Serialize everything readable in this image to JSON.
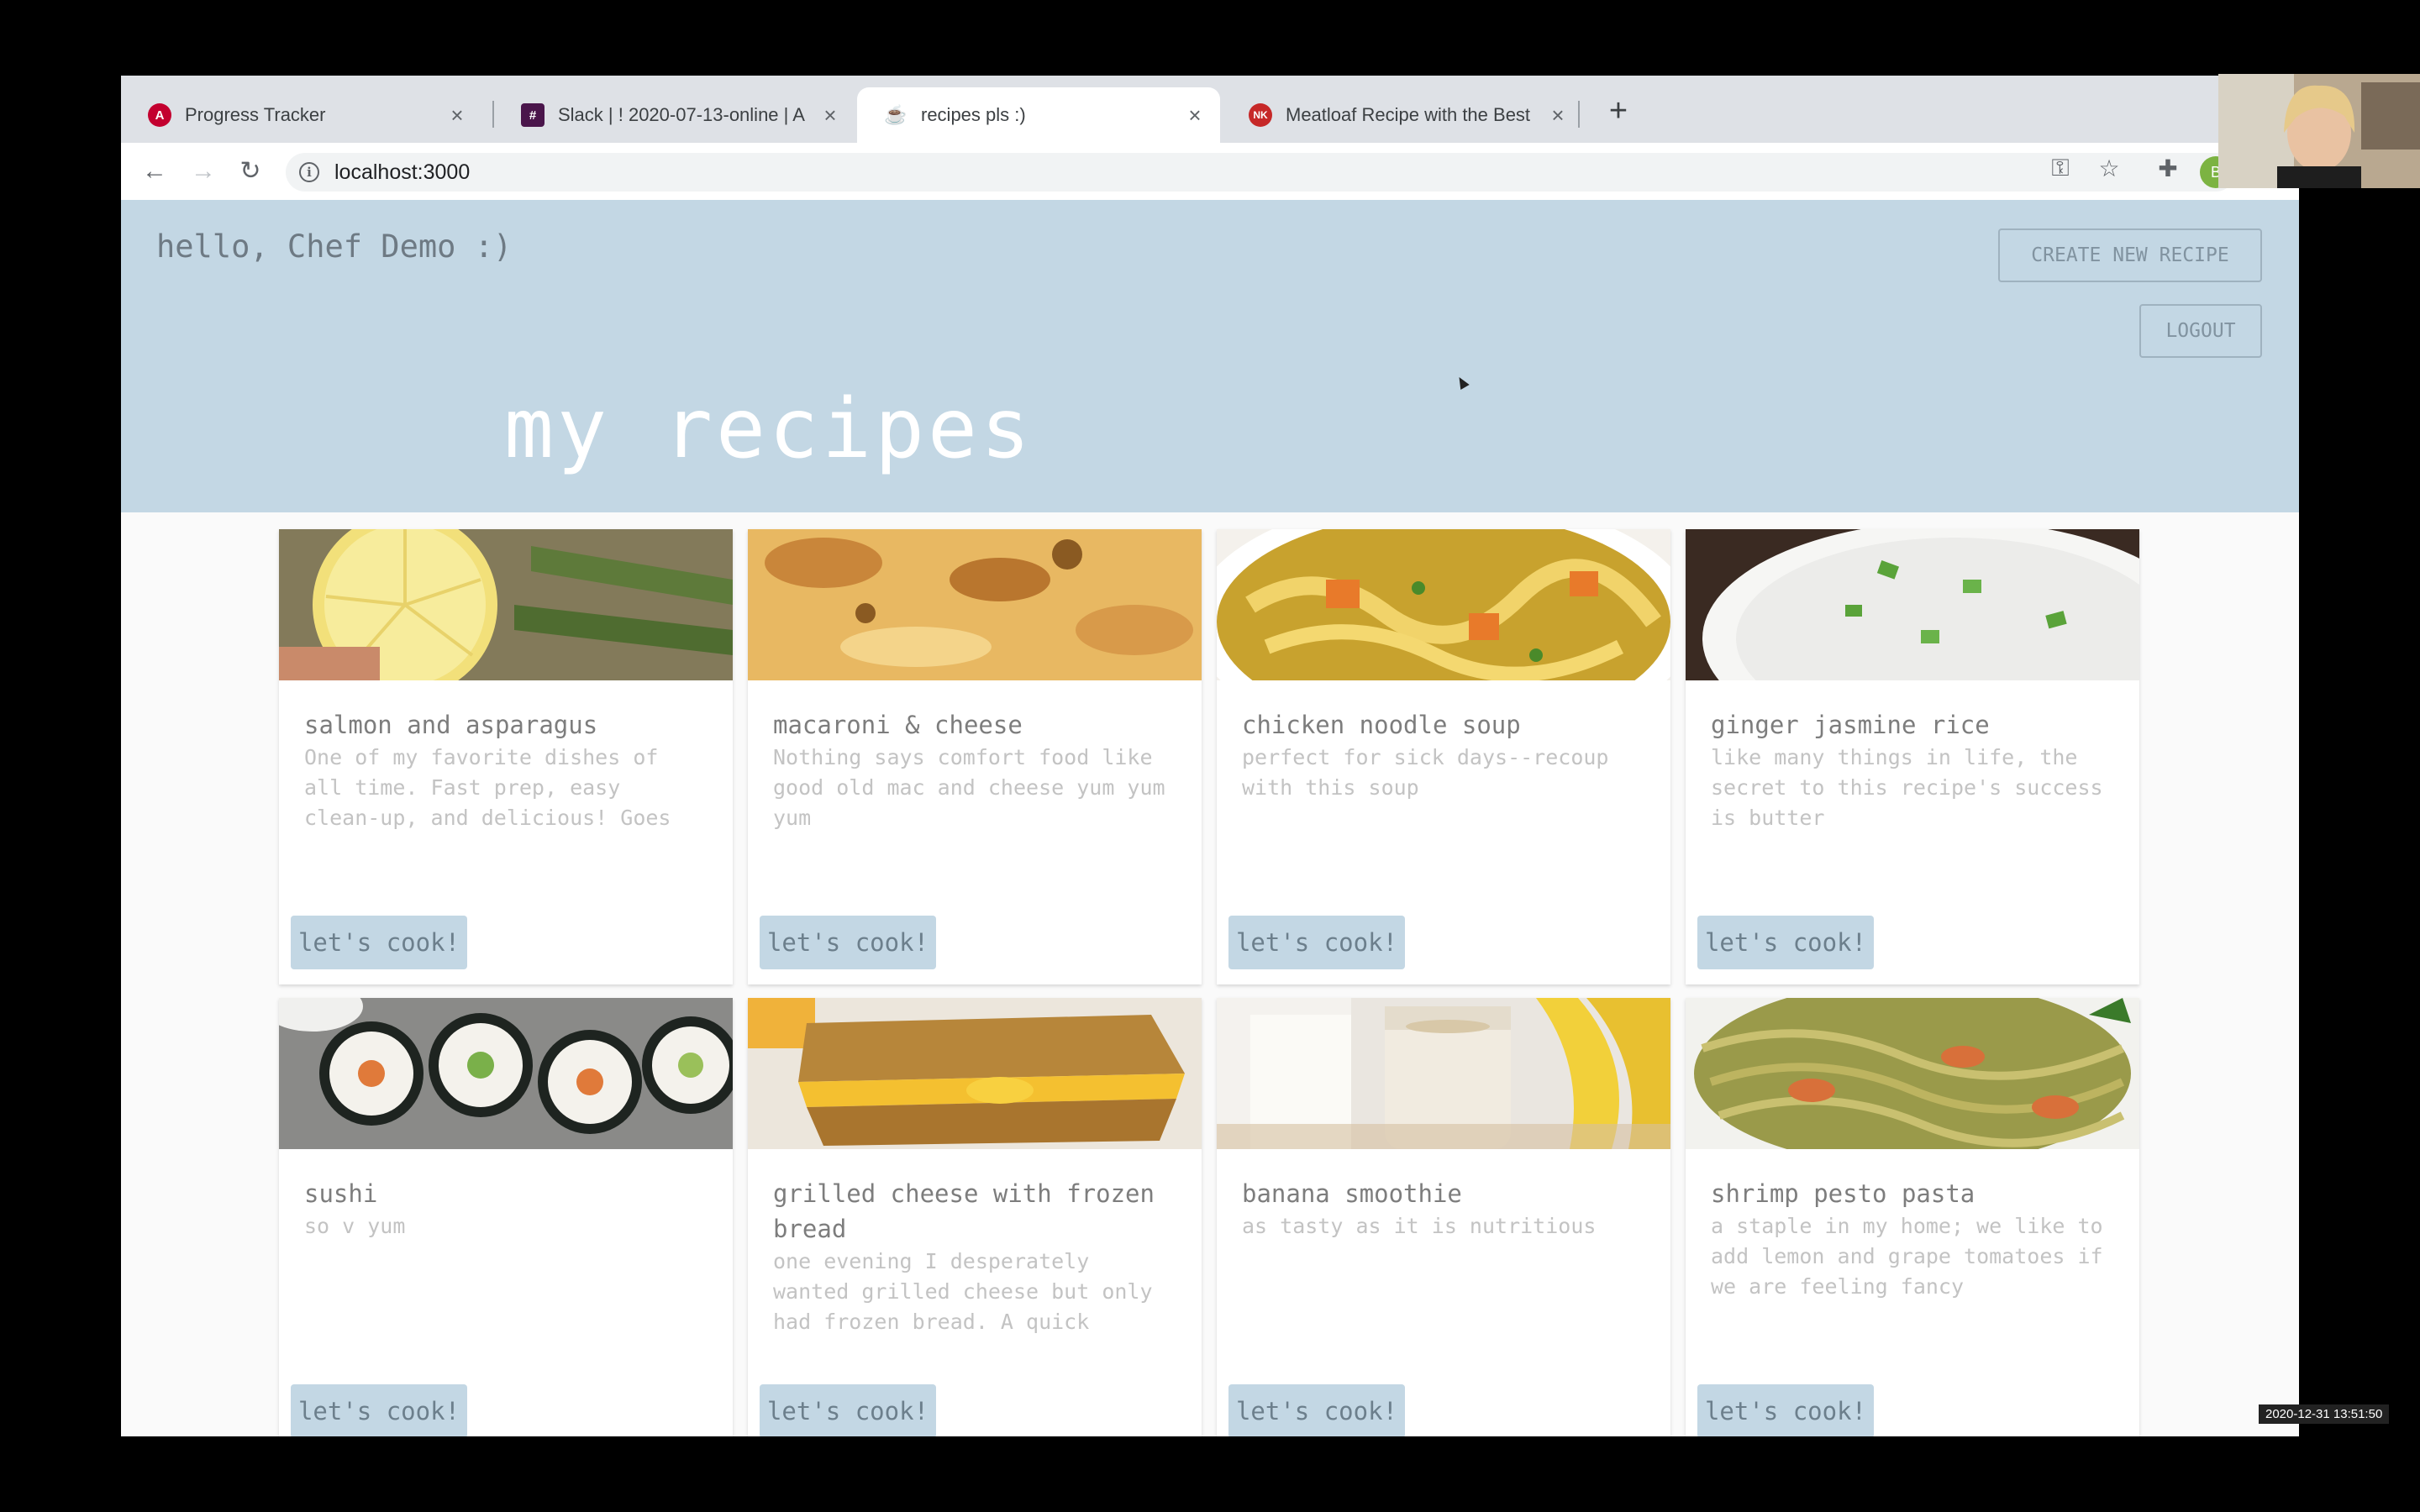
{
  "browser": {
    "tabs": [
      {
        "title": "Progress Tracker",
        "icon": "angular-icon",
        "icon_glyph": "A",
        "icon_color": "#c3002f",
        "active": false
      },
      {
        "title": "Slack | ! 2020-07-13-online | A",
        "icon": "slack-icon",
        "icon_glyph": "#",
        "icon_color": "#4a154b",
        "active": false
      },
      {
        "title": "recipes pls :)",
        "icon": "recipe-app-icon",
        "icon_glyph": "☕",
        "icon_color": "#ffffff",
        "active": true
      },
      {
        "title": "Meatloaf Recipe with the Best",
        "icon": "nk-site-icon",
        "icon_glyph": "NK",
        "icon_color": "#c62828",
        "active": false
      }
    ],
    "new_tab_label": "+",
    "url": "localhost:3000",
    "avatar_initial": "B"
  },
  "header": {
    "greeting": "hello, Chef Demo :)",
    "create_button": "CREATE NEW RECIPE",
    "logout_button": "LOGOUT",
    "page_title": "my recipes",
    "background": "#c3d7e4"
  },
  "recipes": [
    {
      "title": "salmon and asparagus",
      "description": "One of my favorite dishes of all time. Fast prep, easy clean-up, and delicious! Goes",
      "button": "let's cook!"
    },
    {
      "title": "macaroni & cheese",
      "description": "Nothing says comfort food like good old mac and cheese yum yum yum",
      "button": "let's cook!"
    },
    {
      "title": "chicken noodle soup",
      "description": "perfect for sick days--recoup with this soup",
      "button": "let's cook!"
    },
    {
      "title": "ginger jasmine rice",
      "description": "like many things in life, the secret to this recipe's success is butter",
      "button": "let's cook!"
    },
    {
      "title": "sushi",
      "description": "so v yum",
      "button": "let's cook!"
    },
    {
      "title": "grilled cheese with frozen bread",
      "description": "one evening I desperately wanted grilled cheese but only had frozen bread. A quick",
      "button": "let's cook!"
    },
    {
      "title": "banana smoothie",
      "description": "as tasty as it is nutritious",
      "button": "let's cook!"
    },
    {
      "title": "shrimp pesto pasta",
      "description": "a staple in my home; we like to add lemon and grape tomatoes if we are feeling fancy",
      "button": "let's cook!"
    }
  ],
  "timestamp": "2020-12-31 13:51:50"
}
